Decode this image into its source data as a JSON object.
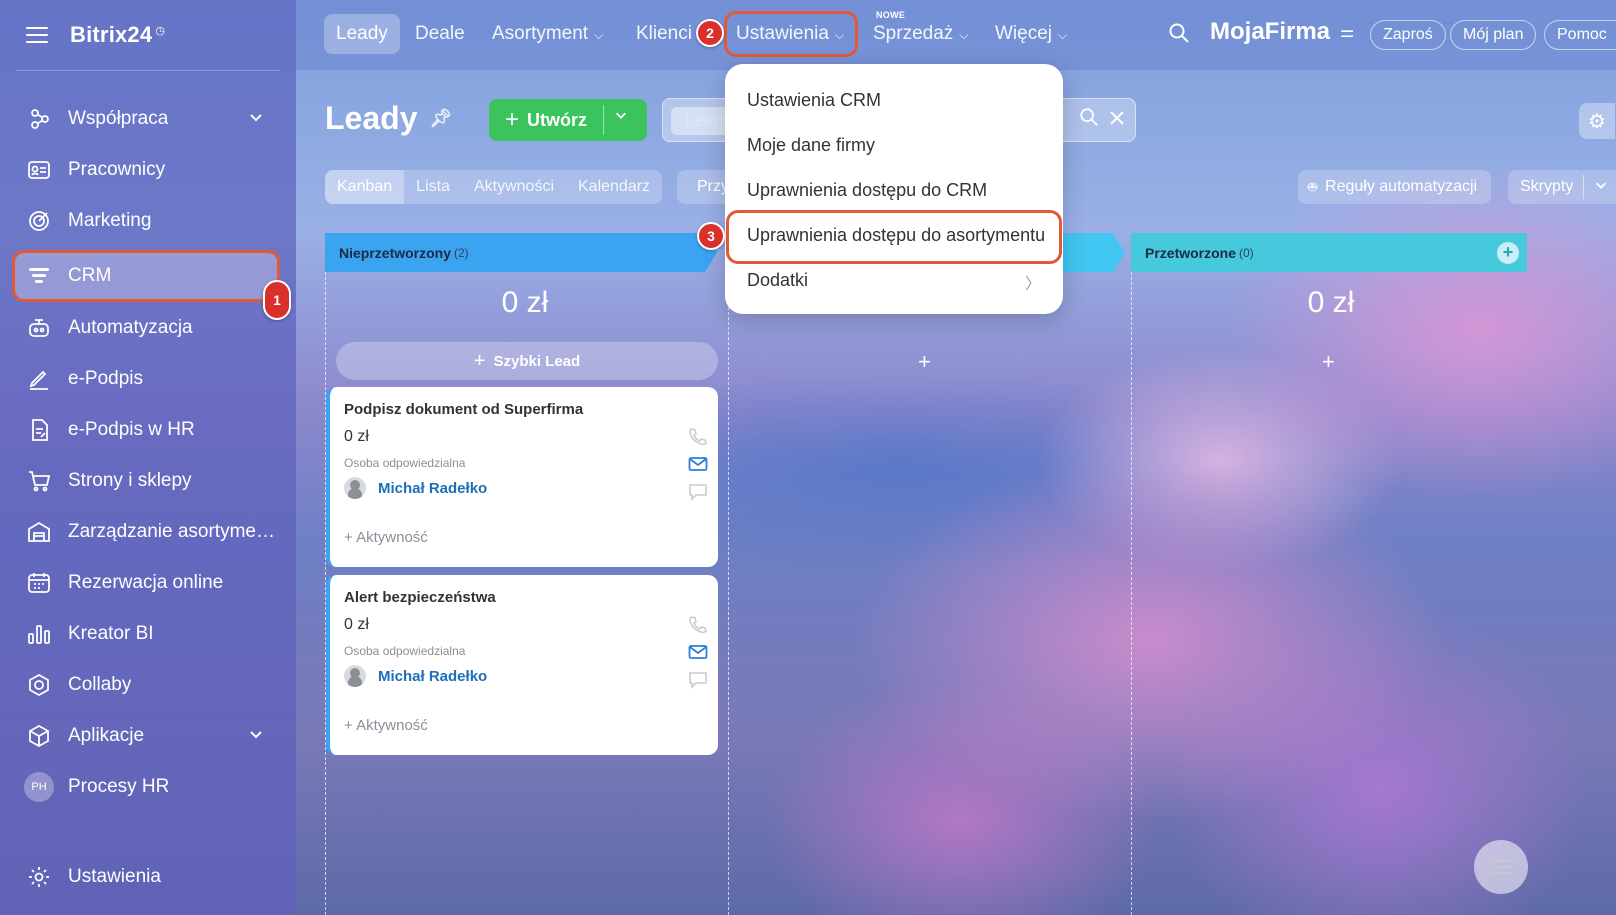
{
  "app": {
    "logo": "Bitrix24",
    "company": "MojaFirma"
  },
  "sidebar": {
    "items": [
      {
        "label": "Współpraca",
        "icon": "collaboration-icon",
        "has_chevron": true
      },
      {
        "label": "Pracownicy",
        "icon": "employees-icon"
      },
      {
        "label": "Marketing",
        "icon": "marketing-icon"
      },
      {
        "label": "CRM",
        "icon": "crm-funnel-icon",
        "active": true
      },
      {
        "label": "Automatyzacja",
        "icon": "automation-icon"
      },
      {
        "label": "e-Podpis",
        "icon": "signature-icon"
      },
      {
        "label": "e-Podpis w HR",
        "icon": "hr-signature-icon"
      },
      {
        "label": "Strony i sklepy",
        "icon": "cart-icon"
      },
      {
        "label": "Zarządzanie asortymen...",
        "icon": "inventory-icon"
      },
      {
        "label": "Rezerwacja online",
        "icon": "calendar-icon"
      },
      {
        "label": "Kreator BI",
        "icon": "bar-chart-icon"
      },
      {
        "label": "Collaby",
        "icon": "hexagon-icon"
      },
      {
        "label": "Aplikacje",
        "icon": "cube-icon",
        "has_chevron": true
      },
      {
        "label": "Procesy HR",
        "icon": "ph-badge",
        "badge": "PH"
      },
      {
        "label": "Ustawienia",
        "icon": "gear-icon"
      }
    ]
  },
  "topnav": {
    "tabs": [
      {
        "label": "Leady",
        "active": true
      },
      {
        "label": "Deale"
      },
      {
        "label": "Asortyment",
        "dropdown": true
      },
      {
        "label": "Klienci"
      },
      {
        "label": "Ustawienia",
        "dropdown": true,
        "highlighted": true
      },
      {
        "label": "Sprzedaż",
        "dropdown": true,
        "new_label": "NOWE"
      },
      {
        "label": "Więcej",
        "dropdown": true
      }
    ],
    "buttons": {
      "invite": "Zaproś",
      "plan": "Mój plan",
      "help": "Pomoc"
    }
  },
  "page": {
    "title": "Leady",
    "create_label": "Utwórz",
    "filter_chip": "Leady",
    "views": [
      "Kanban",
      "Lista",
      "Aktywności",
      "Kalendarz"
    ],
    "active_view": "Kanban",
    "przy_label": "Przy",
    "automation_rules": "Reguły automatyzacji",
    "scripts": "Skrypty"
  },
  "kanban": {
    "columns": [
      {
        "name": "Nieprzetworzony",
        "count": "(2)",
        "sum": "0 zł",
        "color": "#3aa4f0"
      },
      {
        "name": "",
        "count": "",
        "sum": "0 zł",
        "color": "#41c7f2"
      },
      {
        "name": "Przetworzone",
        "count": "(0)",
        "sum": "0 zł",
        "color": "#46c8dd"
      }
    ],
    "quick_lead": "Szybki Lead",
    "cards": [
      {
        "title": "Podpisz dokument od Superfirma",
        "amount": "0 zł",
        "responsible_label": "Osoba odpowiedzialna",
        "user": "Michał Radełko",
        "activity": "+ Aktywność"
      },
      {
        "title": "Alert bezpieczeństwa",
        "amount": "0 zł",
        "responsible_label": "Osoba odpowiedzialna",
        "user": "Michał Radełko",
        "activity": "+ Aktywność"
      }
    ]
  },
  "dropdown_menu": {
    "items": [
      {
        "label": "Ustawienia CRM"
      },
      {
        "label": "Moje dane firmy"
      },
      {
        "label": "Uprawnienia dostępu do CRM"
      },
      {
        "label": "Uprawnienia dostępu do asortymentu",
        "highlighted": true
      },
      {
        "label": "Dodatki",
        "submenu": true
      }
    ]
  },
  "annotations": {
    "steps": [
      "1",
      "2",
      "3"
    ],
    "highlight_color": "#e05a3a",
    "badge_color": "#d9302c"
  },
  "colors": {
    "create_button": "#3bc35d",
    "link": "#1e6fb8"
  }
}
